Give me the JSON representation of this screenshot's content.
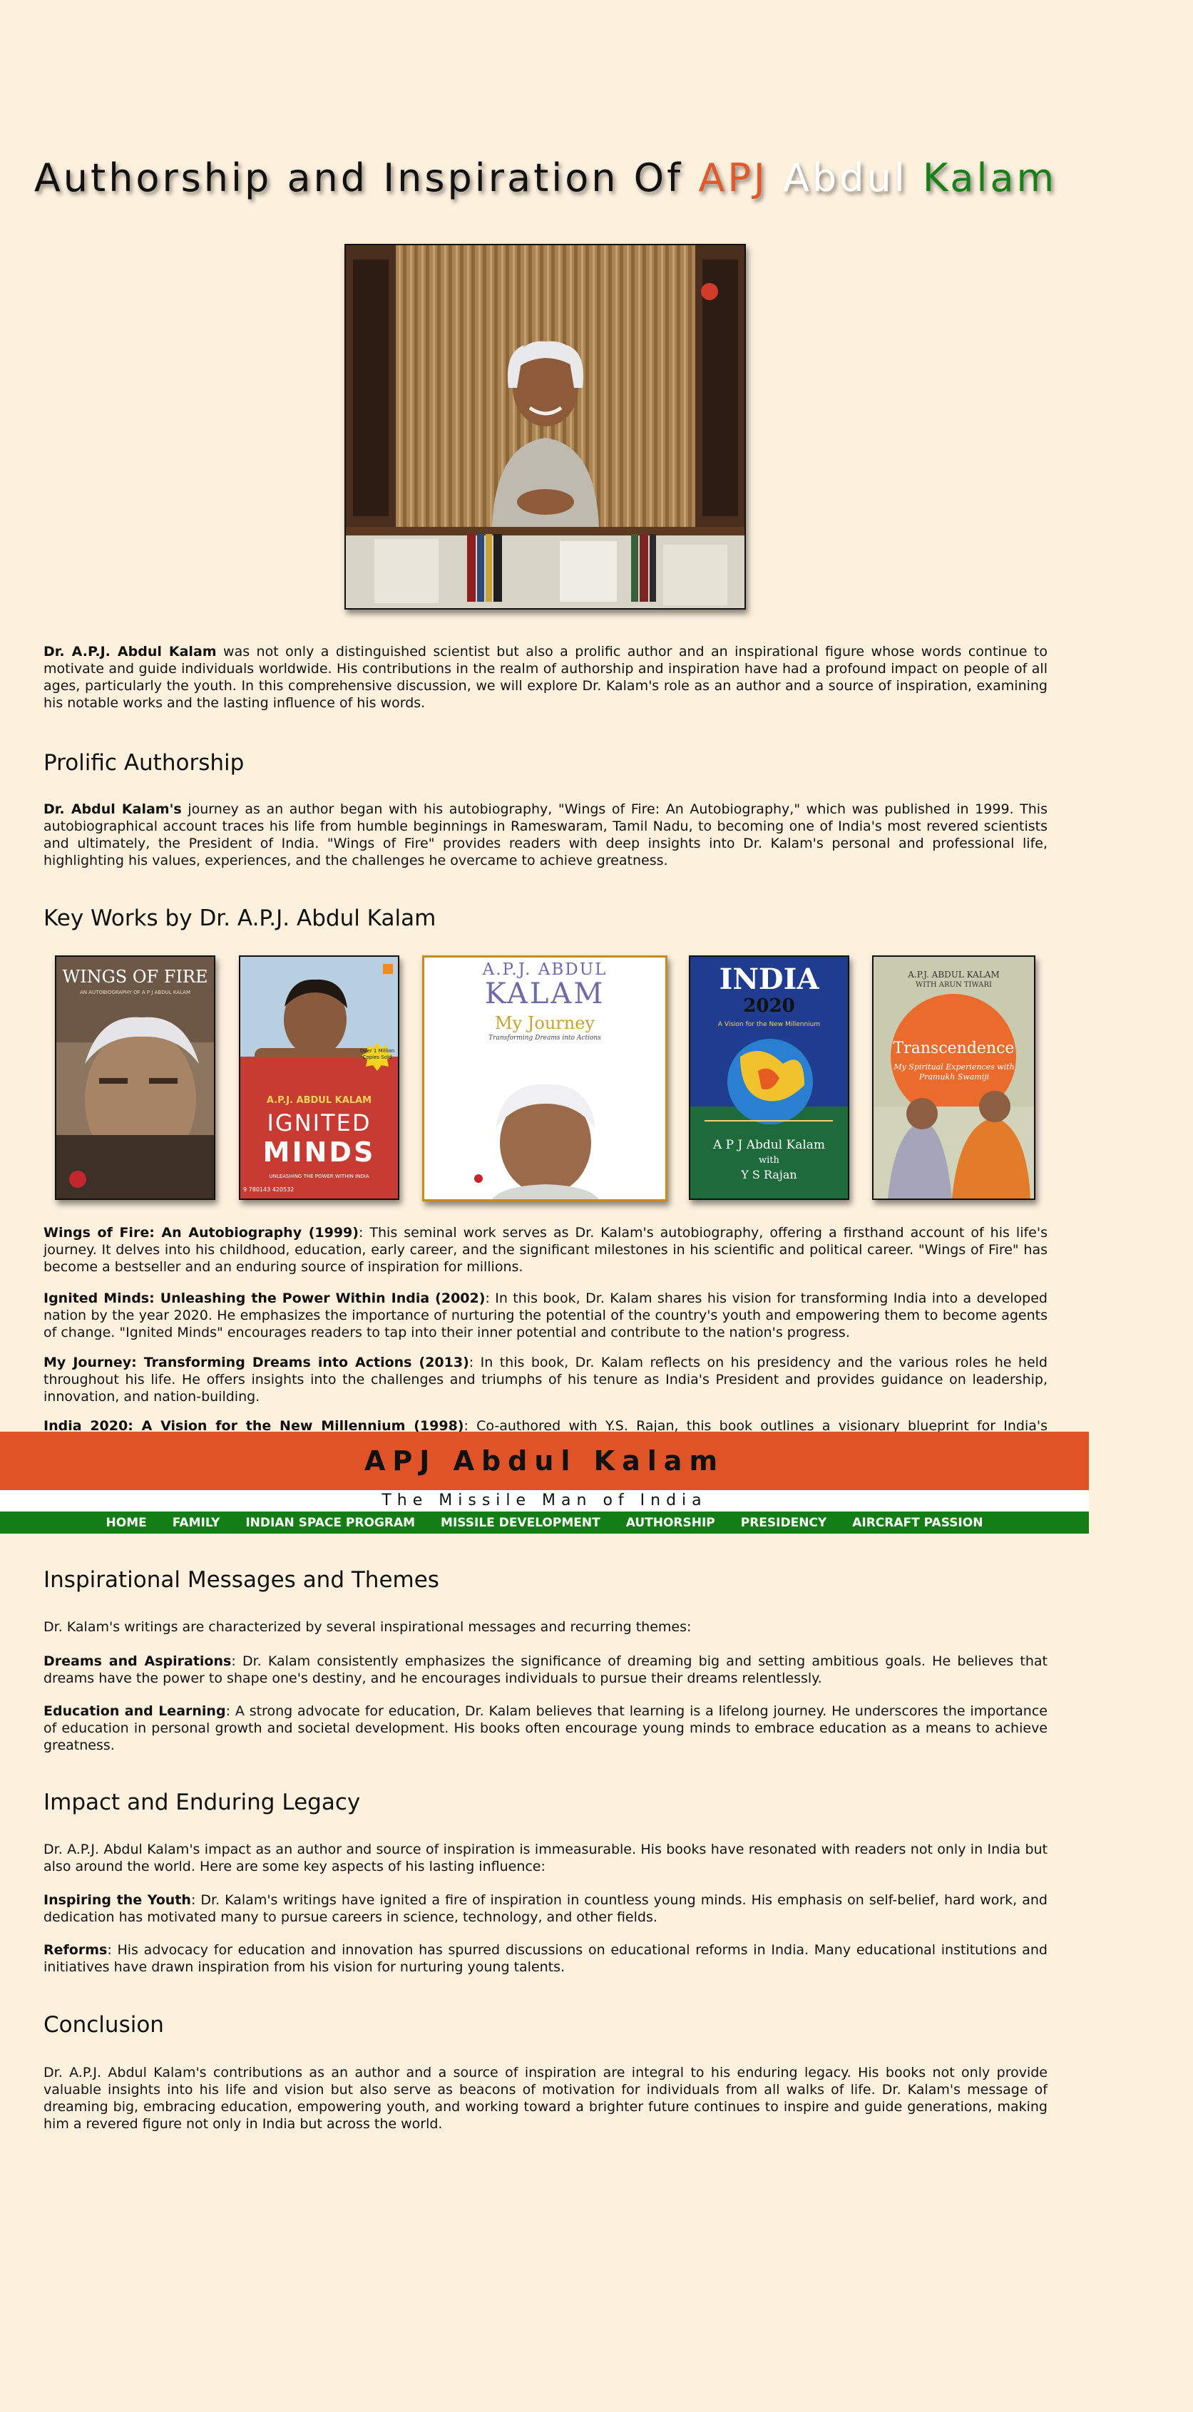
{
  "title": {
    "prefix": "Authorship and Inspiration Of",
    "word1": "APJ",
    "word2": "Abdul",
    "word3": "Kalam"
  },
  "intro": {
    "bold": "Dr. A.P.J. Abdul Kalam",
    "text": " was not only a distinguished scientist but also a prolific author and an inspirational figure whose words continue to motivate and guide individuals worldwide. His contributions in the realm of authorship and inspiration have had a profound impact on people of all ages, particularly the youth. In this comprehensive discussion, we will explore Dr. Kalam's role as an author and a source of inspiration, examining his notable works and the lasting influence of his words."
  },
  "prolific": {
    "heading": "Prolific Authorship",
    "bold": "Dr. Abdul Kalam's",
    "text": " journey as an author began with his autobiography, \"Wings of Fire: An Autobiography,\" which was published in 1999. This autobiographical account traces his life from humble beginnings in Rameswaram, Tamil Nadu, to becoming one of India's most revered scientists and ultimately, the President of India. \"Wings of Fire\" provides readers with deep insights into Dr. Kalam's personal and professional life, highlighting his values, experiences, and the challenges he overcame to achieve greatness."
  },
  "keyworks": {
    "heading": "Key Works by Dr. A.P.J. Abdul Kalam",
    "books": [
      {
        "line1": "WINGS OF FIRE",
        "line2": "AN AUTOBIOGRAPHY OF A P J ABDUL KALAM"
      },
      {
        "badge": "Over 1 Million Copies Sold",
        "author": "A.P.J. ABDUL KALAM",
        "line1": "IGNITED",
        "line2": "MINDS",
        "subtitle": "UNLEASHING THE POWER WITHIN INDIA",
        "isbn": "9 780143 420532"
      },
      {
        "author1": "A.P.J. ABDUL",
        "author2": "KALAM",
        "line1": "My Journey",
        "subtitle": "Transforming Dreams into Actions"
      },
      {
        "line1": "INDIA",
        "line2": "2020",
        "subtitle": "A Vision for the New Millennium",
        "author": "A P J Abdul Kalam",
        "with": "with",
        "coauthor": "Y S Rajan"
      },
      {
        "author": "A.P.J. ABDUL KALAM",
        "coauthor": "WITH ARUN TIWARI",
        "line1": "Transcendence",
        "subtitle": "My Spiritual Experiences with Pramukh Swamiji"
      }
    ],
    "items": [
      {
        "bold": "Wings of Fire: An Autobiography (1999)",
        "text": ": This seminal work serves as Dr. Kalam's autobiography, offering a firsthand account of his life's journey. It delves into his childhood, education, early career, and the significant milestones in his scientific and political career. \"Wings of Fire\" has become a bestseller and an enduring source of inspiration for millions."
      },
      {
        "bold": "Ignited Minds: Unleashing the Power Within India (2002)",
        "text": ": In this book, Dr. Kalam shares his vision for transforming India into a developed nation by the year 2020. He emphasizes the importance of nurturing the potential of the country's youth and empowering them to become agents of change. \"Ignited Minds\" encourages readers to tap into their inner potential and contribute to the nation's progress."
      },
      {
        "bold": "My Journey: Transforming Dreams into Actions (2013)",
        "text": ": In this book, Dr. Kalam reflects on his presidency and the various roles he held throughout his life. He offers insights into the challenges and triumphs of his tenure as India's President and provides guidance on leadership, innovation, and nation-building."
      },
      {
        "bold": "India 2020: A Vision for the New Millennium (1998)",
        "text": ": Co-authored with Y.S. Rajan, this book outlines a visionary blueprint for India's development by"
      }
    ]
  },
  "banner": {
    "name": "APJ Abdul Kalam",
    "tagline": "The Missile Man of India"
  },
  "nav": [
    "HOME",
    "FAMILY",
    "INDIAN SPACE PROGRAM",
    "MISSILE DEVELOPMENT",
    "AUTHORSHIP",
    "PRESIDENCY",
    "AIRCRAFT PASSION"
  ],
  "messages": {
    "heading": "Inspirational Messages and Themes",
    "intro": "Dr. Kalam's writings are characterized by several inspirational messages and recurring themes:",
    "items": [
      {
        "bold": "Dreams and Aspirations",
        "text": ": Dr. Kalam consistently emphasizes the significance of dreaming big and setting ambitious goals. He believes that dreams have the power to shape one's destiny, and he encourages individuals to pursue their dreams relentlessly."
      },
      {
        "bold": "Education and Learning",
        "text": ": A strong advocate for education, Dr. Kalam believes that learning is a lifelong journey. He underscores the importance of education in personal growth and societal development. His books often encourage young minds to embrace education as a means to achieve greatness."
      }
    ]
  },
  "impact": {
    "heading": "Impact and Enduring Legacy",
    "intro": "Dr. A.P.J. Abdul Kalam's impact as an author and source of inspiration is immeasurable. His books have resonated with readers not only in India but also around the world. Here are some key aspects of his lasting influence:",
    "items": [
      {
        "bold": "Inspiring the Youth",
        "text": ": Dr. Kalam's writings have ignited a fire of inspiration in countless young minds. His emphasis on self-belief, hard work, and dedication has motivated many to pursue careers in science, technology, and other fields."
      },
      {
        "bold": "Reforms",
        "text": ": His advocacy for education and innovation has spurred discussions on educational reforms in India. Many educational institutions and initiatives have drawn inspiration from his vision for nurturing young talents."
      }
    ]
  },
  "conclusion": {
    "heading": "Conclusion",
    "text": "Dr. A.P.J. Abdul Kalam's contributions as an author and a source of inspiration are integral to his enduring legacy. His books not only provide valuable insights into his life and vision but also serve as beacons of motivation for individuals from all walks of life. Dr. Kalam's message of dreaming big, embracing education, empowering youth, and working toward a brighter future continues to inspire and guide generations, making him a revered figure not only in India but across the world."
  }
}
